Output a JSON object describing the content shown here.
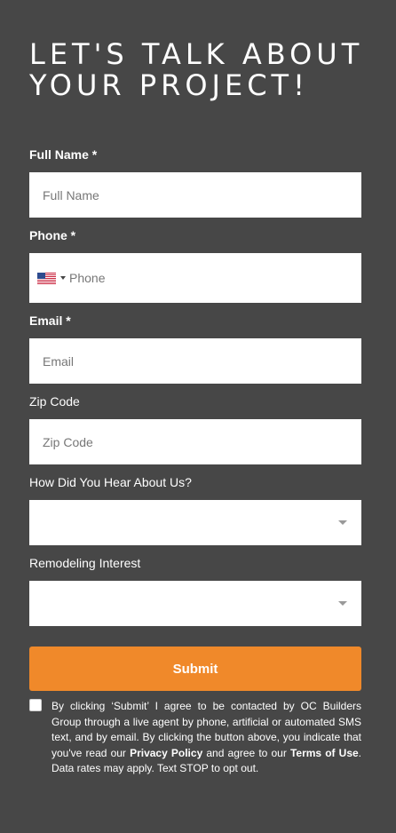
{
  "title": {
    "line1": "LET'S TALK ABOUT",
    "line2": "YOUR PROJECT!"
  },
  "fields": {
    "full_name": {
      "label": "Full Name *",
      "placeholder": "Full Name",
      "value": ""
    },
    "phone": {
      "label": "Phone *",
      "placeholder": "Phone",
      "value": "",
      "country_icon": "us-flag-icon"
    },
    "email": {
      "label": "Email *",
      "placeholder": "Email",
      "value": ""
    },
    "zip": {
      "label": "Zip Code",
      "placeholder": "Zip Code",
      "value": ""
    },
    "hear_about": {
      "label": "How Did You Hear About Us?",
      "selected": ""
    },
    "remodeling": {
      "label": "Remodeling Interest",
      "selected": ""
    }
  },
  "submit_label": "Submit",
  "consent": {
    "checked": false,
    "text_1": "By clicking ‘Submit’ I agree to be contacted by OC Builders Group through a live agent by phone, artificial or automated SMS text, and by email. By clicking the button above, you indicate that you've read our ",
    "privacy_link": "Privacy Policy",
    "text_2": " and agree to our ",
    "terms_link": "Terms of Use",
    "text_3": ". Data rates may apply. Text STOP to opt out."
  },
  "colors": {
    "background": "#474747",
    "accent": "#f0892a",
    "field_bg": "#ffffff"
  }
}
